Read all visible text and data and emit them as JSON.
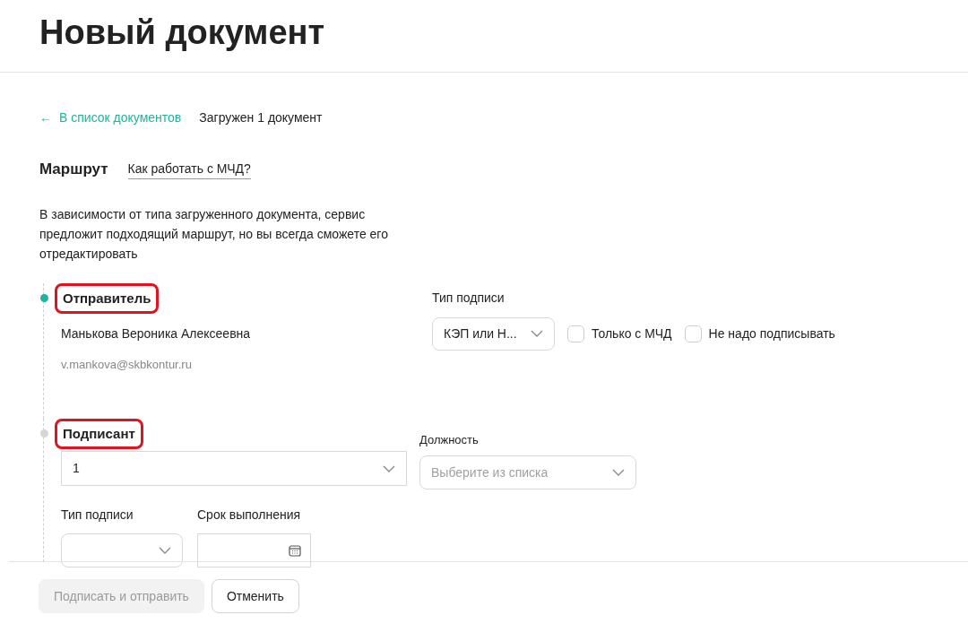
{
  "page_title": "Новый документ",
  "back_link": {
    "arrow": "←",
    "label": "В список документов"
  },
  "upload_status": "Загружен 1 документ",
  "route": {
    "heading": "Маршрут",
    "help_link": "Как работать с МЧД?",
    "description": "В зависимости от типа загруженного документа, сервис предложит подходящий маршрут, но вы всегда сможете его отредактировать"
  },
  "sender": {
    "title": "Отправитель",
    "active": true,
    "highlighted": true,
    "name": "Манькова Вероника Алексеевна",
    "email": "v.mankova@skbkontur.ru",
    "signature_type": {
      "label": "Тип подписи",
      "value": "КЭП или Н..."
    },
    "checkboxes": [
      {
        "label": "Только с МЧД",
        "checked": false
      },
      {
        "label": "Не надо подписывать",
        "checked": false
      }
    ]
  },
  "signer": {
    "title": "Подписант",
    "active": false,
    "highlighted": true,
    "person": {
      "value": "1"
    },
    "position": {
      "label": "Должность",
      "placeholder": "Выберите из списка"
    },
    "signature_type": {
      "label": "Тип подписи"
    },
    "deadline": {
      "label": "Срок выполнения"
    }
  },
  "buttons": [
    {
      "label": "Подписать и отправить",
      "disabled": true
    },
    {
      "label": "Отменить",
      "disabled": false
    }
  ]
}
